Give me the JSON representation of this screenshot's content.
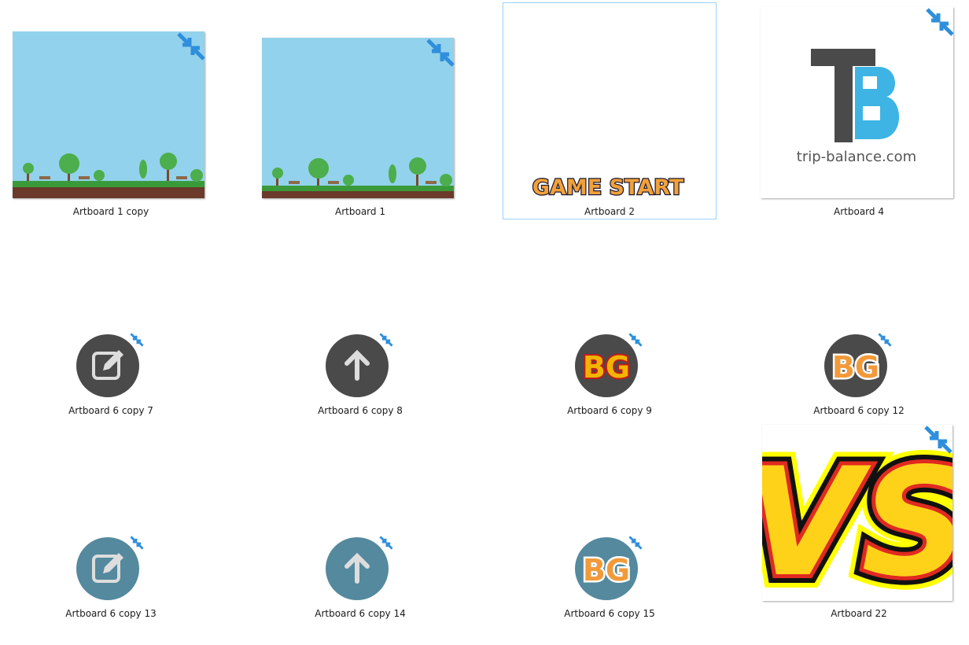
{
  "colors": {
    "sky": "#93d2ec",
    "dark_circle": "#4a4a4a",
    "teal_circle": "#54899e",
    "badge_blue": "#2f8fdc",
    "selection_border": "#99d1ff"
  },
  "files": [
    {
      "name": "Artboard 1 copy",
      "icon": "park-scene-thumbnail"
    },
    {
      "name": "Artboard 1",
      "icon": "park-scene-thumbnail"
    },
    {
      "name": "Artboard 2",
      "icon": "game-start-thumbnail",
      "selected": true
    },
    {
      "name": "Artboard 4",
      "icon": "tb-logo-thumbnail"
    },
    {
      "name": "Artboard 6 copy 7",
      "icon": "edit-icon"
    },
    {
      "name": "Artboard 6 copy 8",
      "icon": "arrow-up-icon"
    },
    {
      "name": "Artboard 6 copy 9",
      "icon": "bg-logo-red"
    },
    {
      "name": "Artboard 6 copy 12",
      "icon": "bg-logo-blue"
    },
    {
      "name": "Artboard 6 copy 13",
      "icon": "edit-icon"
    },
    {
      "name": "Artboard 6 copy 14",
      "icon": "arrow-up-icon"
    },
    {
      "name": "Artboard 6 copy 15",
      "icon": "bg-logo-blue"
    },
    {
      "name": "Artboard 22",
      "icon": "vs-logo"
    }
  ],
  "thumb_text": {
    "game_start": "GAME START",
    "tb_domain": "trip-balance.com",
    "bg": "BG",
    "vs": "VS"
  }
}
